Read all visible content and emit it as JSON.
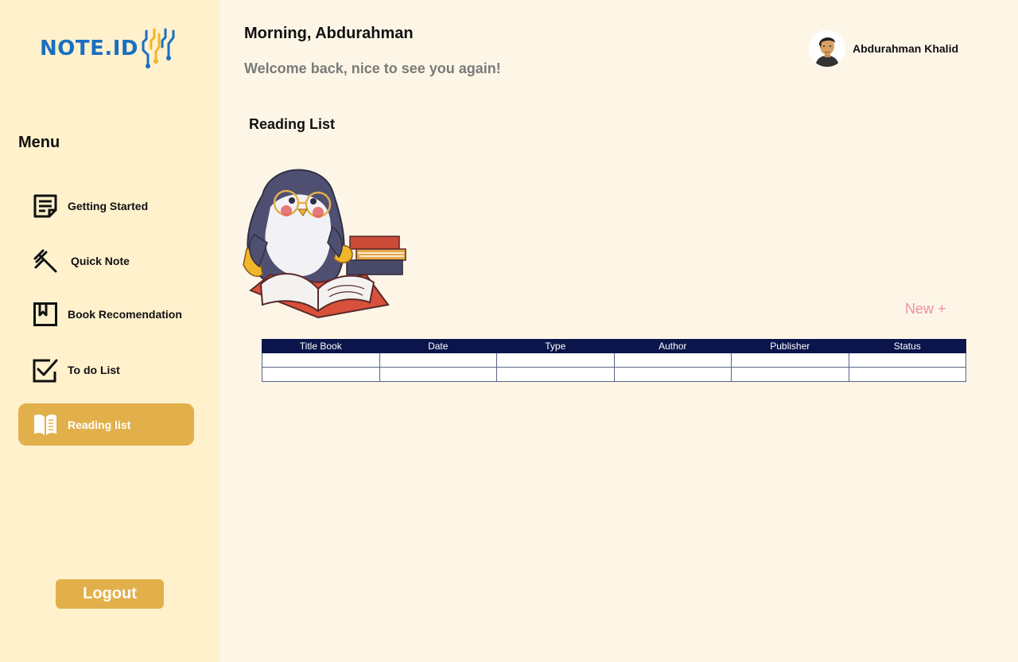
{
  "sidebar": {
    "logo_text": "NOTE.ID",
    "menu_title": "Menu",
    "items": [
      {
        "label": "Getting Started",
        "icon": "note-icon"
      },
      {
        "label": "Quick Note",
        "icon": "pin-icon"
      },
      {
        "label": "Book Recomendation",
        "icon": "bookmark-icon"
      },
      {
        "label": "To do List",
        "icon": "checkbox-icon"
      },
      {
        "label": "Reading list",
        "icon": "open-book-icon",
        "active": true
      }
    ],
    "logout_label": "Logout"
  },
  "header": {
    "greeting": "Morning, Abdurahman",
    "welcome": "Welcome back, nice to see you again!",
    "user_name": "Abdurahman Khalid"
  },
  "main": {
    "section_title": "Reading List",
    "new_button": "New +",
    "table": {
      "columns": [
        "Title Book",
        "Date",
        "Type",
        "Author",
        "Publisher",
        "Status"
      ],
      "rows": [
        [
          "",
          "",
          "",
          "",
          "",
          ""
        ],
        [
          "",
          "",
          "",
          "",
          "",
          ""
        ]
      ]
    }
  },
  "colors": {
    "sidebar_bg": "#fff1cc",
    "page_bg": "#fdf6e7",
    "accent": "#e2b04a",
    "table_header": "#0b154c",
    "logo_blue": "#1a6fc0",
    "new_button": "#f08fa6"
  }
}
